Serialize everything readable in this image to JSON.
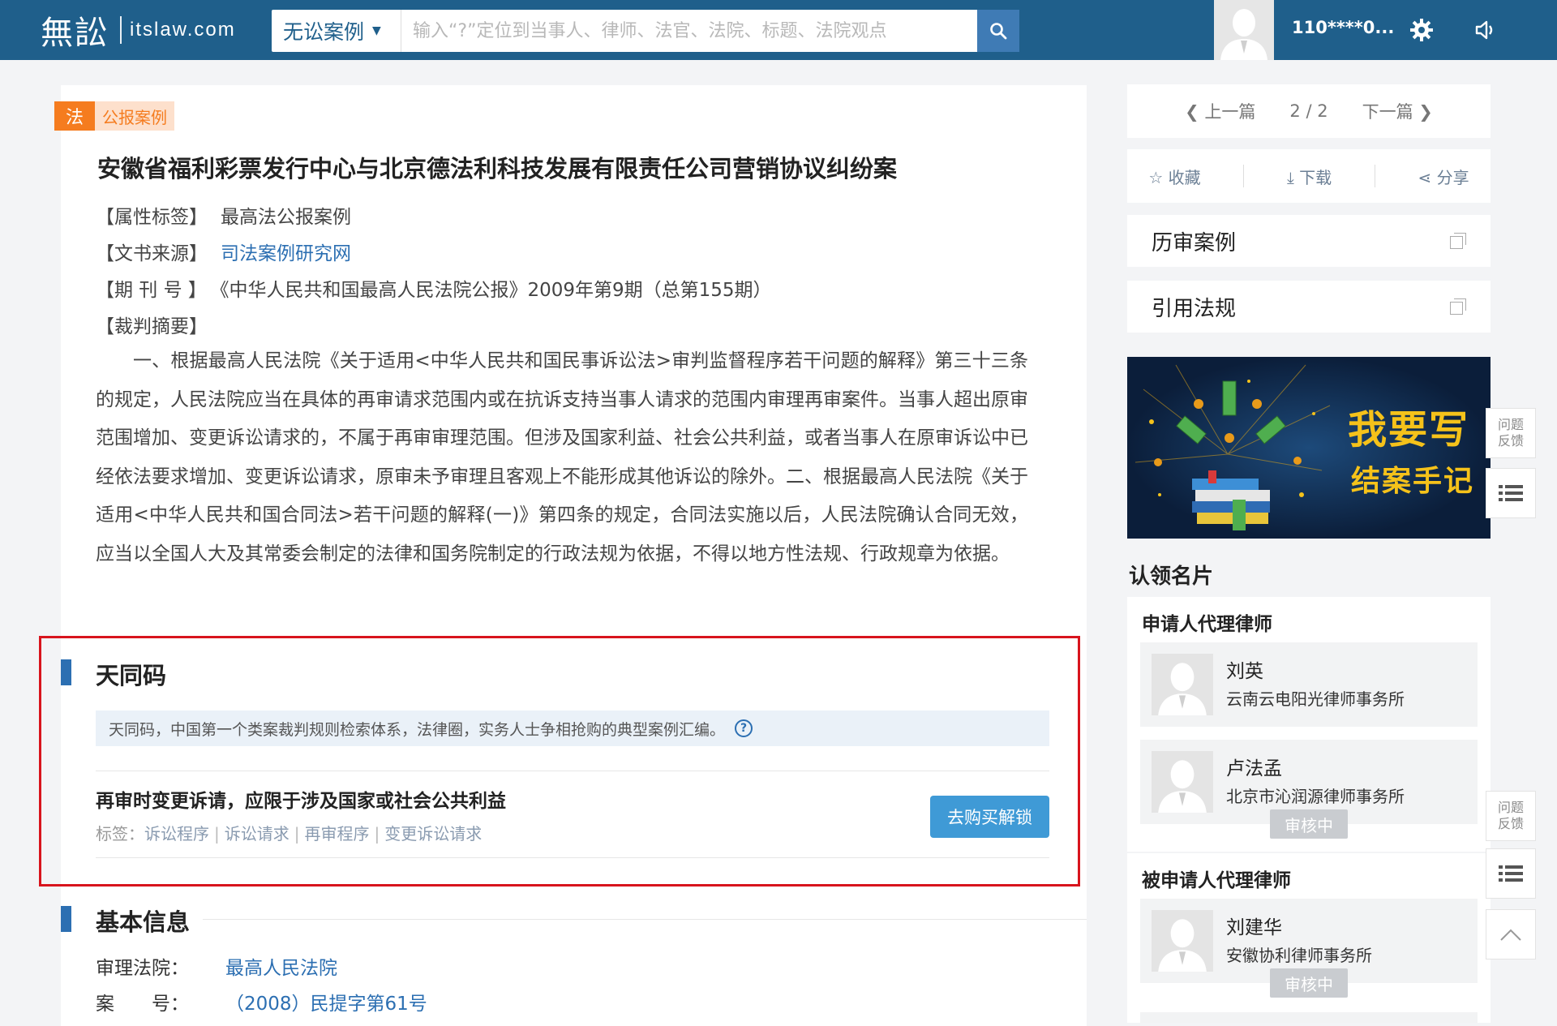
{
  "header": {
    "logo_mark": "無訟",
    "logo_text": "itslaw.com",
    "search_category": "无讼案例",
    "search_placeholder": "输入“?”定位到当事人、律师、法官、法院、标题、法院观点",
    "user_name": "110****0..."
  },
  "article": {
    "tag_law": "法",
    "tag_case": "公报案例",
    "title": "安徽省福利彩票发行中心与北京德法利科技发展有限责任公司营销协议纠纷案",
    "meta": [
      {
        "label": "【属性标签】",
        "value": "最高法公报案例"
      },
      {
        "label": "【文书来源】",
        "value": "司法案例研究网"
      },
      {
        "label": "【期 刊 号 】",
        "value": "《中华人民共和国最高人民法院公报》2009年第9期（总第155期）"
      },
      {
        "label": "【裁判摘要】",
        "value": ""
      }
    ],
    "summary": "一、根据最高人民法院《关于适用<中华人民共和国民事诉讼法>审判监督程序若干问题的解释》第三十三条的规定，人民法院应当在具体的再审请求范围内或在抗诉支持当事人请求的范围内审理再审案件。当事人超出原审范围增加、变更诉讼请求的，不属于再审审理范围。但涉及国家利益、社会公共利益，或者当事人在原审诉讼中已经依法要求增加、变更诉讼请求，原审未予审理且客观上不能形成其他诉讼的除外。二、根据最高人民法院《关于适用<中华人民共和国合同法>若干问题的解释(一)》第四条的规定，合同法实施以后，人民法院确认合同无效，应当以全国人大及其常委会制定的法律和国务院制定的行政法规为依据，不得以地方性法规、行政规章为依据。"
  },
  "tiantong": {
    "section_title": "天同码",
    "intro": "天同码，中国第一个类案裁判规则检索体系，法律圈，实务人士争相抢购的典型案例汇编。",
    "help_icon": "?",
    "rule_title": "再审时变更诉请，应限于涉及国家或社会公共利益",
    "tags_label": "标签：",
    "tags": [
      "诉讼程序",
      "诉讼请求",
      "再审程序",
      "变更诉讼请求"
    ],
    "buy_button": "去购买解锁"
  },
  "basic_info": {
    "section_title": "基本信息",
    "rows": [
      {
        "label": "审理法院：",
        "value": "最高人民法院"
      },
      {
        "label": "案　　号：",
        "value": "（2008）民提字第61号"
      }
    ]
  },
  "sidebar": {
    "prev": "上一篇",
    "page": "2 / 2",
    "next": "下一篇",
    "actions": [
      "收藏",
      "下载",
      "分享"
    ],
    "links": [
      "历审案例",
      "引用法规"
    ],
    "banner_line1": "我要写",
    "banner_line2": "结案手记",
    "claim_title": "认领名片",
    "applicant_head": "申请人代理律师",
    "respondent_head": "被申请人代理律师",
    "applicant_lawyers": [
      {
        "name": "刘英",
        "firm": "云南云电阳光律师事务所",
        "status": ""
      },
      {
        "name": "卢法孟",
        "firm": "北京市沁润源律师事务所",
        "status": "审核中"
      }
    ],
    "respondent_lawyers": [
      {
        "name": "刘建华",
        "firm": "安徽协利律师事务所",
        "status": "审核中"
      }
    ]
  },
  "floating": {
    "feedback": "问题反馈"
  }
}
